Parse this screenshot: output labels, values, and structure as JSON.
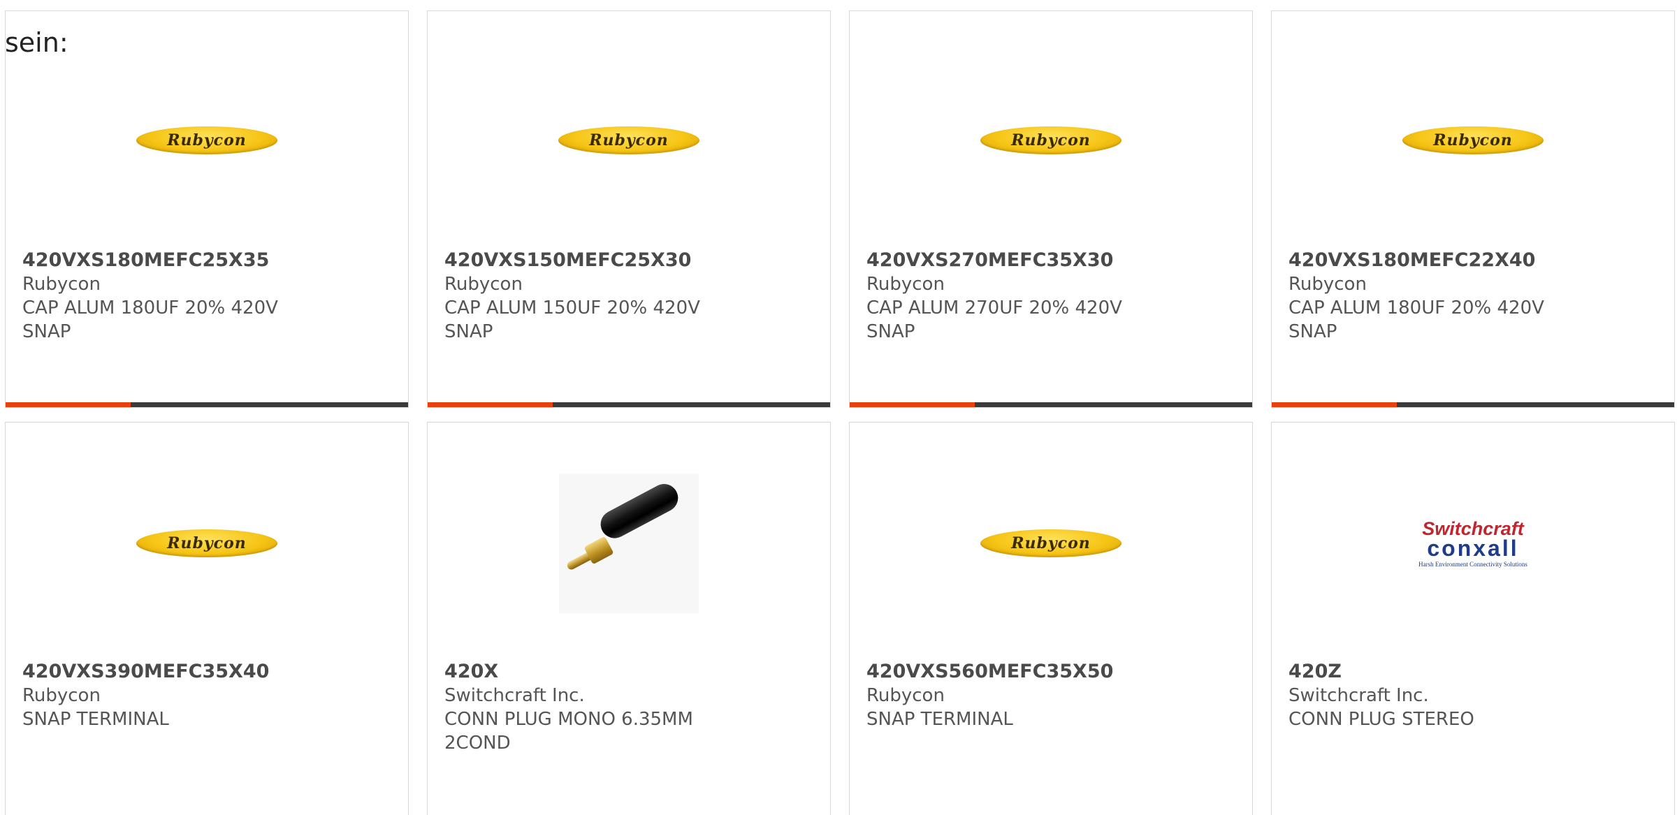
{
  "intro_text": "sein:",
  "colors": {
    "accent": "#e8410d",
    "bar_track": "#3a3a3a",
    "text": "#555555",
    "card_border": "#d9d9d9"
  },
  "products": [
    {
      "part_number": "420VXS180MEFC25X35",
      "manufacturer": "Rubycon",
      "description": "CAP ALUM 180UF 20% 420V SNAP",
      "image": "rubycon-logo",
      "logo_text": "Rubycon",
      "progress": 0.31
    },
    {
      "part_number": "420VXS150MEFC25X30",
      "manufacturer": "Rubycon",
      "description": "CAP ALUM 150UF 20% 420V SNAP",
      "image": "rubycon-logo",
      "logo_text": "Rubycon",
      "progress": 0.31
    },
    {
      "part_number": "420VXS270MEFC35X30",
      "manufacturer": "Rubycon",
      "description": "CAP ALUM 270UF 20% 420V SNAP",
      "image": "rubycon-logo",
      "logo_text": "Rubycon",
      "progress": 0.31
    },
    {
      "part_number": "420VXS180MEFC22X40",
      "manufacturer": "Rubycon",
      "description": "CAP ALUM 180UF 20% 420V SNAP",
      "image": "rubycon-logo",
      "logo_text": "Rubycon",
      "progress": 0.31
    },
    {
      "part_number": "420VXS390MEFC35X40",
      "manufacturer": "Rubycon",
      "description": "SNAP TERMINAL",
      "image": "rubycon-logo",
      "logo_text": "Rubycon"
    },
    {
      "part_number": "420X",
      "manufacturer": "Switchcraft Inc.",
      "description": "CONN PLUG MONO 6.35MM 2COND",
      "image": "audio-plug-photo"
    },
    {
      "part_number": "420VXS560MEFC35X50",
      "manufacturer": "Rubycon",
      "description": "SNAP TERMINAL",
      "image": "rubycon-logo",
      "logo_text": "Rubycon"
    },
    {
      "part_number": "420Z",
      "manufacturer": "Switchcraft Inc.",
      "description": "CONN PLUG STEREO",
      "image": "switchcraft-conxall-logo",
      "logo_lines": [
        "Switchcraft",
        "conxall",
        "Harsh Environment Connectivity Solutions"
      ]
    }
  ]
}
